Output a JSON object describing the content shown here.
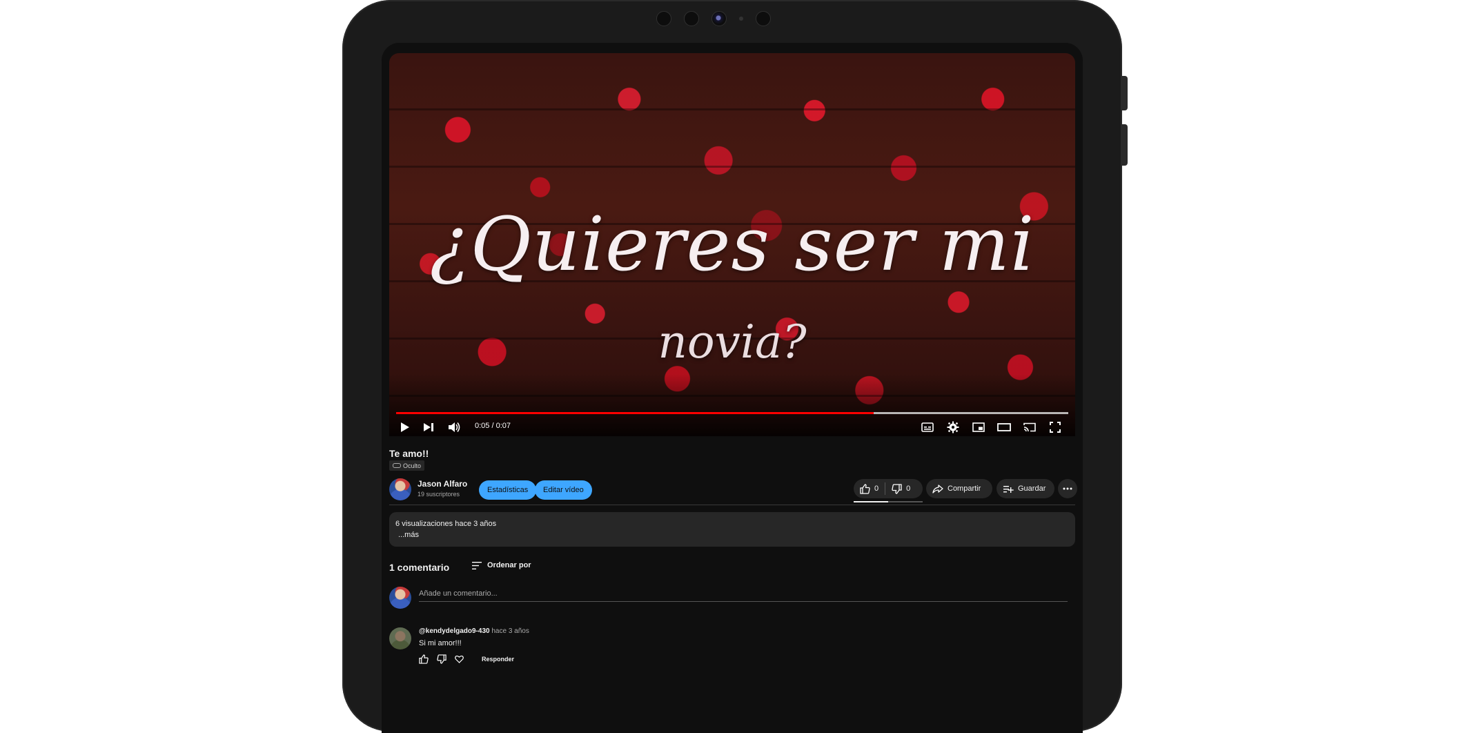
{
  "video": {
    "overlay_line1": "¿Quieres ser mi",
    "overlay_line2": "novia?",
    "time": "0:05 / 0:07",
    "progress_fraction": 0.71,
    "buffer_fraction": 1.0,
    "accent": "#ff0000"
  },
  "title": "Te amo!!",
  "visibility": "Oculto",
  "channel": {
    "name": "Jason Alfaro",
    "subscribers": "19 suscriptores"
  },
  "buttons": {
    "stats": "Estadísticas",
    "edit": "Editar vídeo",
    "likes": "0",
    "dislikes": "0",
    "share": "Compartir",
    "save": "Guardar"
  },
  "description": {
    "meta": "6 visualizaciones  hace 3 años",
    "more": "...más"
  },
  "comments": {
    "count": "1 comentario",
    "sort": "Ordenar por",
    "placeholder": "Añade un comentario...",
    "items": [
      {
        "author": "@kendydelgado9-430",
        "time": "hace 3 años",
        "text": "Si mi amor!!!",
        "reply": "Responder"
      }
    ]
  },
  "colors": {
    "accent_blue": "#3ea6ff",
    "background": "#0f0f0f"
  }
}
